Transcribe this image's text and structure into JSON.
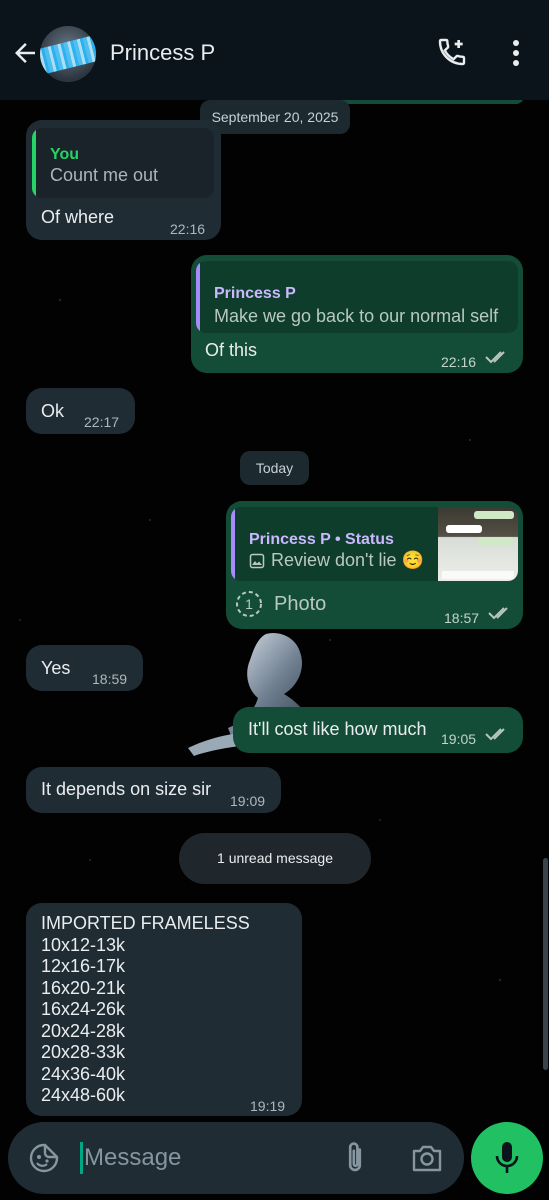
{
  "header": {
    "contact_name": "Princess P",
    "back_icon": "arrow-left-icon",
    "call_icon": "add-call-icon",
    "menu_icon": "more-vert-icon"
  },
  "date_chips": {
    "first": "September 20, 2025",
    "second": "Today"
  },
  "messages": [
    {
      "direction": "in",
      "quote_name": "You",
      "quote_text": "Count me out",
      "text": "Of where",
      "time": "22:16"
    },
    {
      "direction": "out",
      "quote_name": "Princess P",
      "quote_text": "Make we go back to our normal self",
      "text": "Of this",
      "time": "22:16",
      "status": "read"
    },
    {
      "direction": "in",
      "text": "Ok",
      "time": "22:17"
    },
    {
      "direction": "out",
      "quote_name": "Princess P • Status",
      "quote_text": "Review don't lie ☺️",
      "text": "Photo",
      "view_once": "1",
      "time": "18:57",
      "status": "read"
    },
    {
      "direction": "in",
      "text": "Yes",
      "time": "18:59"
    },
    {
      "direction": "out",
      "text": "It'll cost like how much",
      "time": "19:05",
      "status": "read"
    },
    {
      "direction": "in",
      "text": "It depends on size sir",
      "time": "19:09"
    },
    {
      "direction": "in",
      "lines": [
        "IMPORTED FRAMELESS",
        "10x12-13k",
        "12x16-17k",
        "16x20-21k",
        "16x24-26k",
        "20x24-28k",
        "20x28-33k",
        "24x36-40k",
        "24x48-60k"
      ],
      "time": "19:19"
    }
  ],
  "unread_banner": "1 unread message",
  "composer": {
    "placeholder": "Message",
    "emoji_icon": "sticker-icon",
    "attach_icon": "paperclip-icon",
    "camera_icon": "camera-icon",
    "mic_icon": "mic-icon"
  },
  "colors": {
    "incoming_bubble": "#202c33",
    "outgoing_bubble": "#144d37",
    "accent_green": "#21c063",
    "quote_you": "#25d366",
    "quote_other": "#a78bfa"
  }
}
